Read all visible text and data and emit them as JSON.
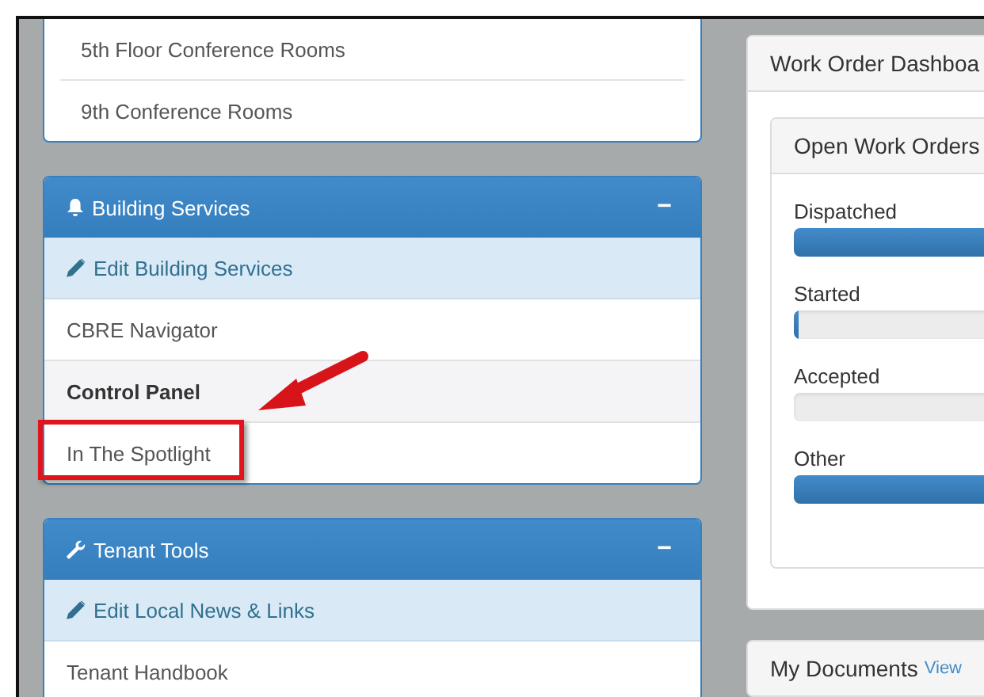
{
  "rooms_panel": {
    "items": [
      "5th Floor Conference Rooms",
      "9th Conference Rooms"
    ]
  },
  "sections": [
    {
      "title": "Building Services",
      "collapse": "−",
      "edit_label": "Edit Building Services",
      "items": [
        {
          "label": "CBRE Navigator",
          "selected": false,
          "highlighted": false
        },
        {
          "label": "Control Panel",
          "selected": true,
          "highlighted": false
        },
        {
          "label": "In The Spotlight",
          "selected": false,
          "highlighted": true
        }
      ]
    },
    {
      "title": "Tenant Tools",
      "collapse": "−",
      "edit_label": "Edit Local News & Links",
      "items": [
        {
          "label": "Tenant Handbook",
          "selected": false,
          "highlighted": false
        }
      ]
    }
  ],
  "dashboard": {
    "title": "Work Order Dashboa",
    "open_orders": {
      "title": "Open Work Orders",
      "bars": [
        {
          "label": "Dispatched",
          "level": 1
        },
        {
          "label": "Started",
          "level": 0.02
        },
        {
          "label": "Accepted",
          "level": 0
        },
        {
          "label": "Other",
          "level": 1
        }
      ]
    }
  },
  "documents": {
    "title": "My Documents",
    "link": "View"
  }
}
